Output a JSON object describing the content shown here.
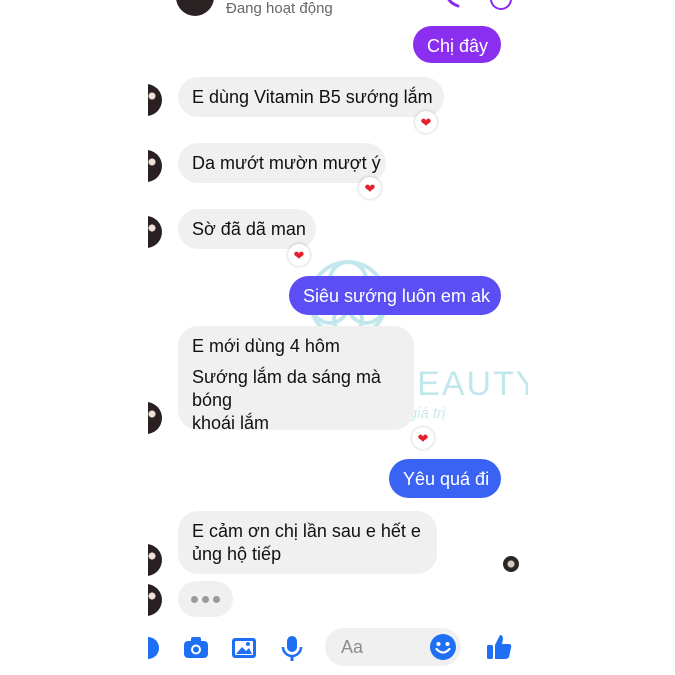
{
  "header": {
    "status": "Đang hoạt động"
  },
  "messages": [
    {
      "side": "out",
      "text": "Chị đây"
    },
    {
      "side": "in",
      "text": "E dùng Vitamin B5 sướng lắm",
      "reaction": "❤"
    },
    {
      "side": "in",
      "text": "Da mướt mườn mượt ý",
      "reaction": "❤"
    },
    {
      "side": "in",
      "text": "Sờ đã dã man",
      "reaction": "❤"
    },
    {
      "side": "out",
      "text": "Siêu sướng luôn em ak"
    },
    {
      "side": "in",
      "lines": [
        "E mới dùng 4 hôm",
        "Sướng lắm da sáng mà bóng",
        "khoái lắm"
      ],
      "reaction": "❤"
    },
    {
      "side": "out",
      "text": "Yêu quá đi"
    },
    {
      "side": "in",
      "lines": [
        "E cảm ơn chị lần sau e hết e",
        "ủng hộ tiếp"
      ]
    }
  ],
  "composer": {
    "placeholder": "Aa"
  },
  "watermark": {
    "name": "HATHOR BEAUTY",
    "slogan": "Nơi vẻ đẹp trở thành giá trị"
  },
  "colors": {
    "accent": "#7b2cf3",
    "accent_blue": "#1e6ff4",
    "reaction_red": "#e4202c",
    "incoming_bg": "#f0f0f1",
    "watermark": "#8fd5e0"
  },
  "icons": [
    "camera-icon",
    "photo-icon",
    "microphone-icon",
    "emoji-icon",
    "thumbs-up-icon",
    "phone-icon",
    "video-icon"
  ]
}
